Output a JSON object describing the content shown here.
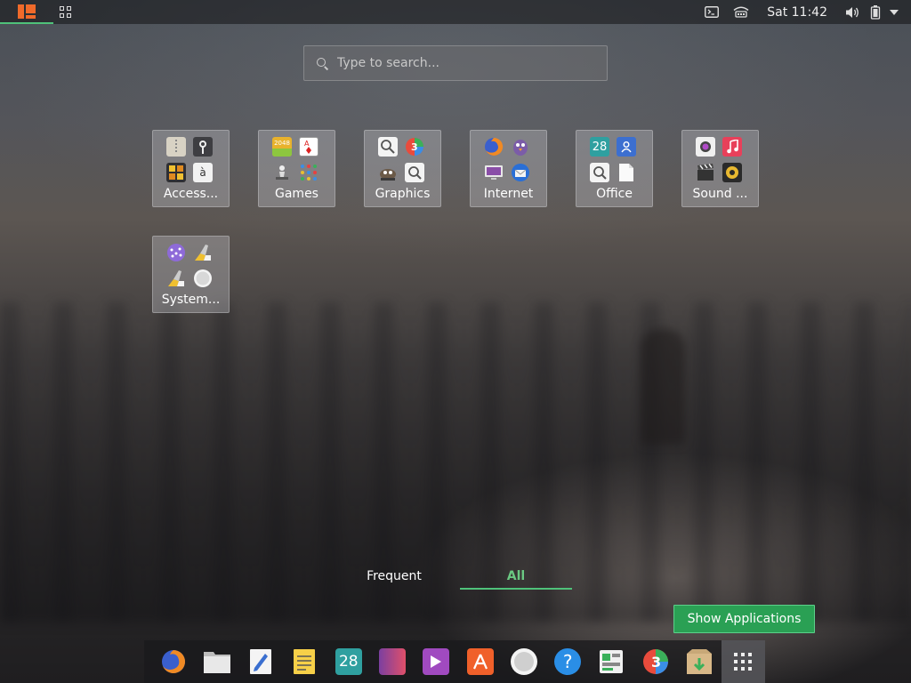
{
  "top_panel": {
    "menu_icon": "app-menu-logo-icon",
    "workspaces_icon": "workspaces-grid-icon",
    "terminal_icon": "terminal-icon",
    "network_icon": "network-icon",
    "clock": "Sat 11:42",
    "volume_icon": "volume-icon",
    "battery_icon": "battery-icon",
    "system_menu_icon": "chevron-down-icon"
  },
  "search": {
    "placeholder": "Type to search...",
    "value": ""
  },
  "folders": [
    {
      "label": "Access...",
      "icons": [
        "archive-icon",
        "map-pin-icon",
        "calculator-icon",
        "character-map-icon"
      ]
    },
    {
      "label": "Games",
      "icons": [
        "2048-icon",
        "cards-icon",
        "chess-icon",
        "lines-icon"
      ]
    },
    {
      "label": "Graphics",
      "icons": [
        "viewer-icon",
        "3d-icon",
        "gimp-icon",
        "magnifier-icon"
      ]
    },
    {
      "label": "Internet",
      "icons": [
        "firefox-icon",
        "pidgin-icon",
        "remote-desktop-icon",
        "thunderbird-icon"
      ]
    },
    {
      "label": "Office",
      "icons": [
        "calendar-icon",
        "contacts-icon",
        "document-viewer-icon",
        "document-icon"
      ]
    },
    {
      "label": "Sound ...",
      "icons": [
        "camera-icon",
        "music-icon",
        "video-editor-icon",
        "speaker-icon"
      ]
    },
    {
      "label": "System...",
      "icons": [
        "settings-orb-icon",
        "cleaner-icon",
        "cleaner-2-icon",
        "disk-icon"
      ]
    }
  ],
  "office_calendar_day": "28",
  "games_2048_text": "2048",
  "character_map_text": "à",
  "tabs": {
    "frequent": "Frequent",
    "all": "All"
  },
  "show_apps_label": "Show Applications",
  "dock": {
    "items": [
      "firefox-icon",
      "files-icon",
      "text-editor-icon",
      "notes-icon",
      "calendar-icon",
      "photos-icon",
      "videos-icon",
      "software-center-icon",
      "disk-icon",
      "help-icon",
      "system-monitor-icon",
      "3d-icon",
      "archive-manager-icon",
      "show-apps-grid-icon"
    ],
    "calendar_day": "28",
    "help_glyph": "?"
  },
  "colors": {
    "accent_green": "#4fc27a",
    "button_green": "#2aa054",
    "logo_orange": "#f06a2a"
  }
}
